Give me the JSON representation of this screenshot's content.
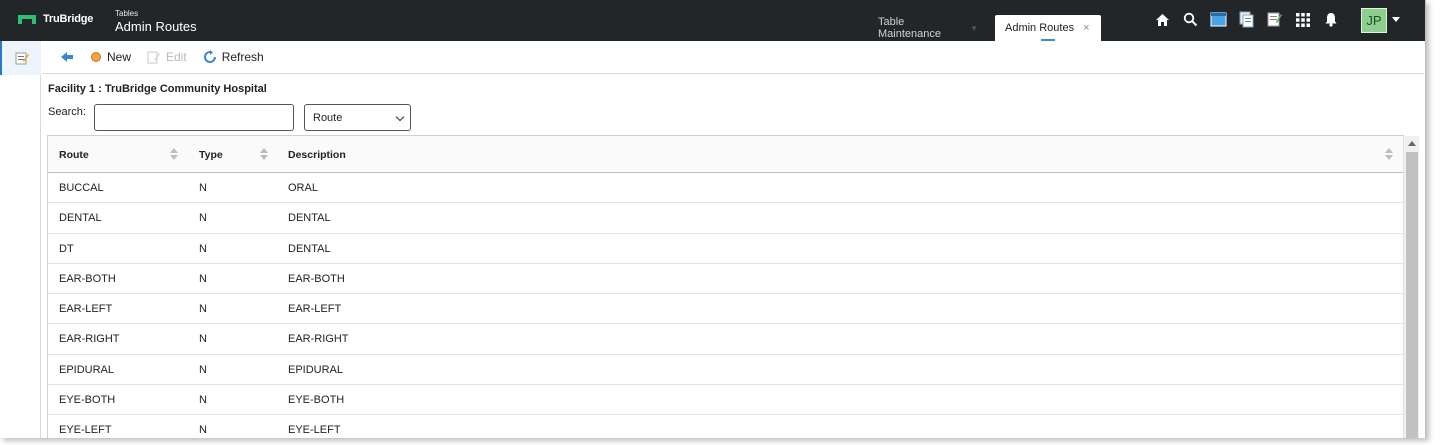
{
  "header": {
    "brand": "TruBridge",
    "title_small": "Tables",
    "title_main": "Admin Routes",
    "tabs": [
      {
        "label": "Table Maintenance",
        "active": false
      },
      {
        "label": "Admin Routes",
        "active": true
      }
    ],
    "close_glyph": "×",
    "user_initials": "JP",
    "icons": [
      "home-icon",
      "search-icon",
      "window-icon",
      "documents-icon",
      "notes-icon",
      "apps-grid-icon",
      "bell-icon"
    ]
  },
  "toolbar": {
    "back_icon": "back-arrow-icon",
    "new_label": "New",
    "edit_label": "Edit",
    "refresh_label": "Refresh"
  },
  "content": {
    "facility": "Facility 1 : TruBridge Community Hospital",
    "search_label": "Search:",
    "search_value": "",
    "select_value": "Route"
  },
  "table": {
    "columns": [
      "Route",
      "Type",
      "Description"
    ],
    "rows": [
      [
        "BUCCAL",
        "N",
        "ORAL"
      ],
      [
        "DENTAL",
        "N",
        "DENTAL"
      ],
      [
        "DT",
        "N",
        "DENTAL"
      ],
      [
        "EAR-BOTH",
        "N",
        "EAR-BOTH"
      ],
      [
        "EAR-LEFT",
        "N",
        "EAR-LEFT"
      ],
      [
        "EAR-RIGHT",
        "N",
        "EAR-RIGHT"
      ],
      [
        "EPIDURAL",
        "N",
        "EPIDURAL"
      ],
      [
        "EYE-BOTH",
        "N",
        "EYE-BOTH"
      ],
      [
        "EYE-LEFT",
        "N",
        "EYE-LEFT"
      ]
    ]
  },
  "colors": {
    "topbar": "#232629",
    "brand_green": "#2fbf71",
    "avatar_bg": "#8ccf8f",
    "accent_blue": "#2c77c9"
  }
}
